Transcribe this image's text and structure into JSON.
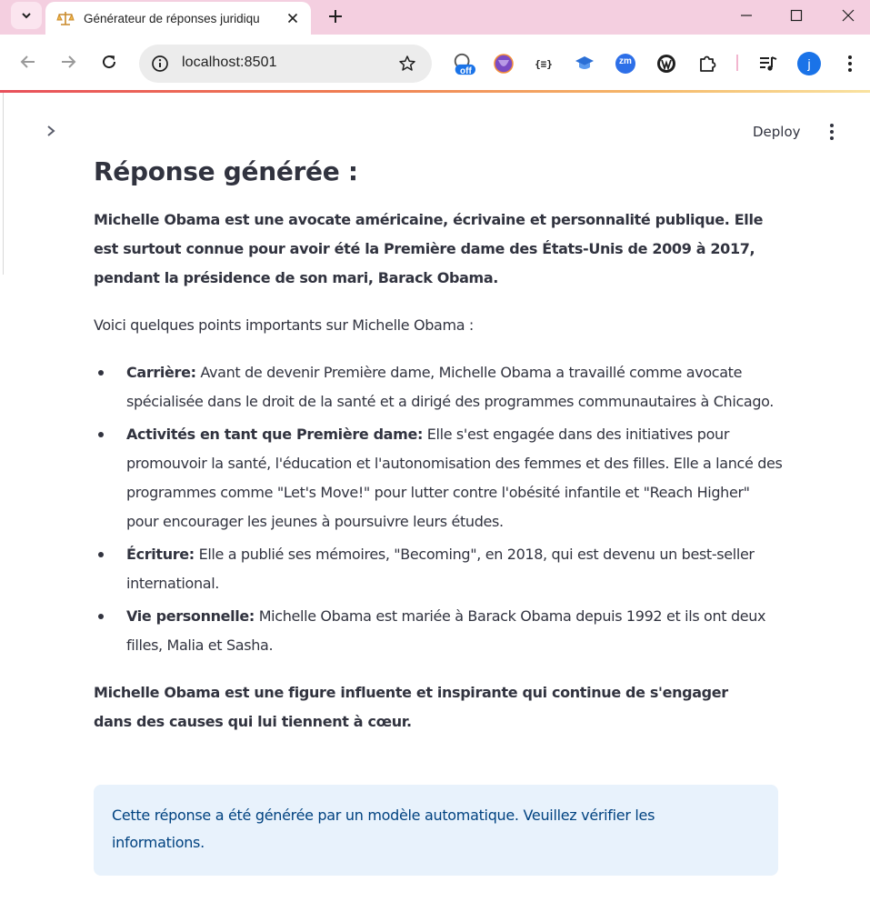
{
  "browser": {
    "tab_title": "Générateur de réponses juridiqu",
    "url": "localhost:8501",
    "profile_initial": "j",
    "extension_badge": "off",
    "ext_zm_label": "zm",
    "ext_json_label": "{≡}"
  },
  "app": {
    "deploy_label": "Deploy",
    "heading": "Réponse générée :",
    "intro": "Michelle Obama est une avocate américaine, écrivaine et personnalité publique. Elle est surtout connue pour avoir été la Première dame des États-Unis de 2009 à 2017, pendant la présidence de son mari, Barack Obama.",
    "lead": "Voici quelques points importants sur Michelle Obama :",
    "points": [
      {
        "title": "Carrière:",
        "text": " Avant de devenir Première dame, Michelle Obama a travaillé comme avocate spécialisée dans le droit de la santé et a dirigé des programmes communautaires à Chicago."
      },
      {
        "title": "Activités en tant que Première dame:",
        "text": " Elle s'est engagée dans des initiatives pour promouvoir la santé, l'éducation et l'autonomisation des femmes et des filles. Elle a lancé des programmes comme \"Let's Move!\" pour lutter contre l'obésité infantile et \"Reach Higher\" pour encourager les jeunes à poursuivre leurs études."
      },
      {
        "title": "Écriture:",
        "text": " Elle a publié ses mémoires, \"Becoming\", en 2018, qui est devenu un best-seller international."
      },
      {
        "title": "Vie personnelle:",
        "text": " Michelle Obama est mariée à Barack Obama depuis 1992 et ils ont deux filles, Malia et Sasha."
      }
    ],
    "outro": "Michelle Obama est une figure influente et inspirante qui continue de s'engager dans des causes qui lui tiennent à cœur.",
    "info_alert": "Cette réponse a été générée par un modèle automatique. Veuillez vérifier les informations."
  },
  "colors": {
    "tabstrip": "#f4cfe0",
    "text": "#31333f",
    "alert_bg": "#e8f2fc",
    "alert_text": "#004280",
    "profile": "#1a73e8"
  }
}
